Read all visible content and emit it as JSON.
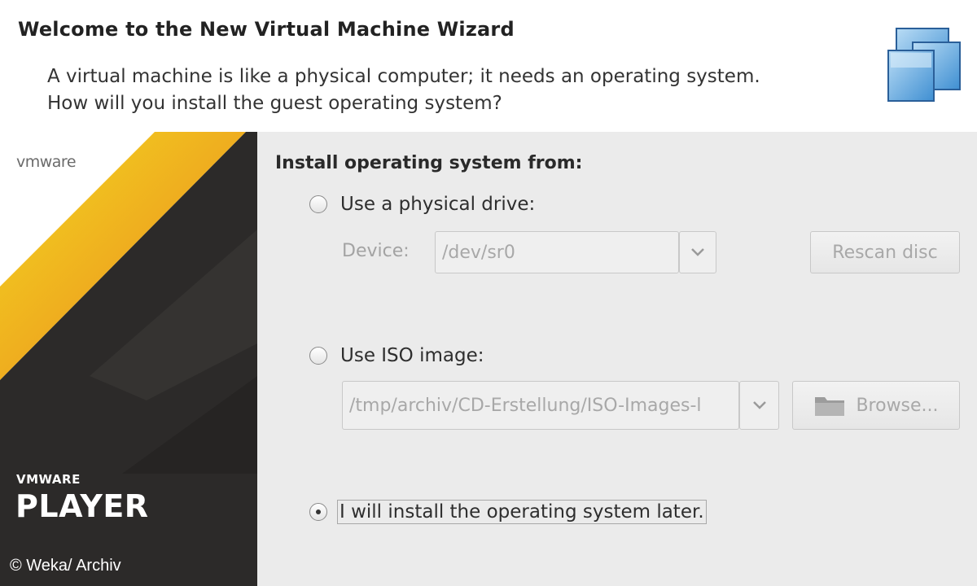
{
  "header": {
    "title": "Welcome to the New Virtual Machine Wizard",
    "description_line1": "A virtual machine is like a physical computer; it needs an operating system.",
    "description_line2": "How will you install the guest operating system?"
  },
  "sidebar": {
    "logo_text": "vmware",
    "brand_small": "VMWARE",
    "brand_big": "PLAYER",
    "copyright": "© Weka/ Archiv",
    "colors": {
      "orange": "#e8921e",
      "yellow": "#f2d21c",
      "dark": "#2a2827"
    }
  },
  "main": {
    "section_title": "Install operating system from:",
    "options": [
      {
        "label": "Use a physical drive:",
        "selected": false
      },
      {
        "label": "Use ISO image:",
        "selected": false
      },
      {
        "label": "I will install the operating system later.",
        "selected": true
      }
    ],
    "device_label": "Device:",
    "device_value": "/dev/sr0",
    "rescan_label": "Rescan disc",
    "iso_path": "/tmp/archiv/CD-Erstellung/ISO-Images-l",
    "browse_label": "Browse..."
  },
  "icons": {
    "wizard": "stacked-windows-icon",
    "dropdown": "chevron-down-icon",
    "folder": "folder-icon"
  }
}
